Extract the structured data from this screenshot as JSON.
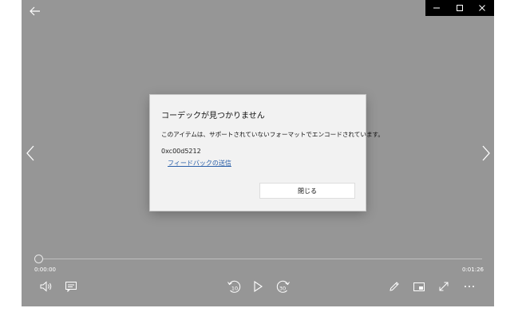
{
  "window": {
    "controls": [
      "minimize",
      "maximize",
      "close"
    ]
  },
  "dialog": {
    "title": "コーデックが見つかりません",
    "message": "このアイテムは、サポートされていないフォーマットでエンコードされています。",
    "error_code": "0xc00d5212",
    "feedback_link": "フィードバックの送信",
    "close_button": "閉じる"
  },
  "player": {
    "current_time": "0:00:00",
    "total_time": "0:01:26",
    "progress": 0,
    "skip_back_seconds": "10",
    "skip_forward_seconds": "30"
  },
  "icons": {
    "back": "back-arrow-icon",
    "prev": "chevron-left-icon",
    "next": "chevron-right-icon",
    "volume": "speaker-icon",
    "captions": "captions-icon",
    "play": "play-icon",
    "edit": "pen-icon",
    "miniview": "mini-view-icon",
    "fullscreen": "fullscreen-icon",
    "more": "more-icon"
  }
}
